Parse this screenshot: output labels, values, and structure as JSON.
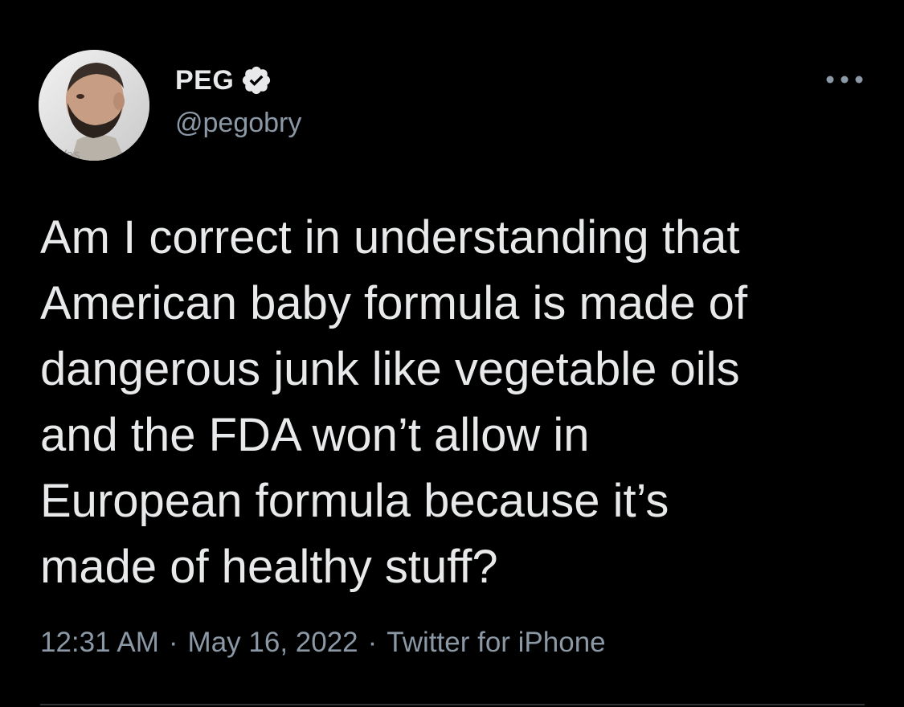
{
  "user": {
    "display_name": "PEG",
    "handle": "@pegobry",
    "verified": true,
    "verified_badge_color": "#e7e9ea",
    "avatar_icon": "profile-photo"
  },
  "tweet": {
    "text": "Am I correct in understanding that\nAmerican baby formula is made of\ndangerous junk like vegetable oils\nand the FDA won’t allow in\nEuropean formula because it’s\nmade of healthy stuff?",
    "time": "12:31 AM",
    "date": "May 16, 2022",
    "separator": "·",
    "source": "Twitter for iPhone"
  },
  "actions": {
    "more_icon": "more-horizontal-icon"
  },
  "colors": {
    "background": "#000000",
    "primary_text": "#e7e9ea",
    "secondary_text": "#8b98a5",
    "divider": "#2f3336"
  }
}
